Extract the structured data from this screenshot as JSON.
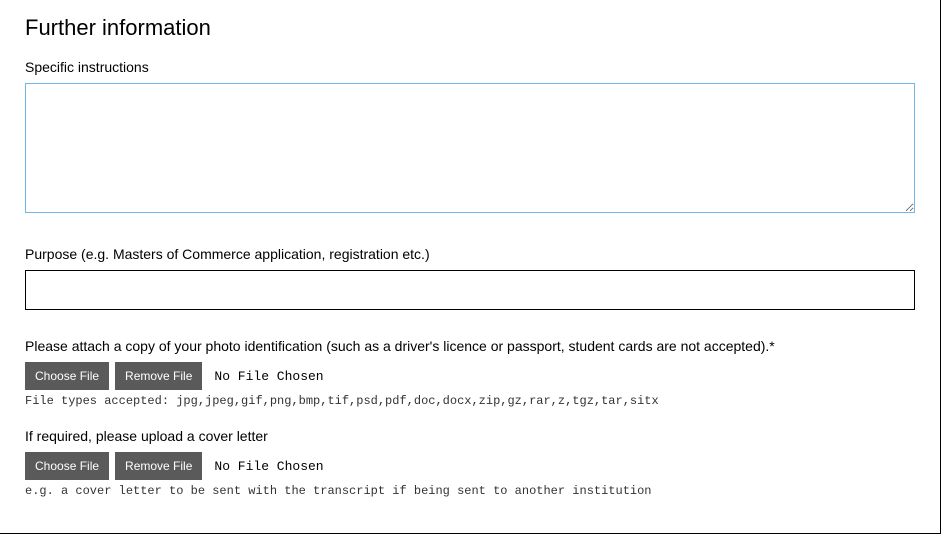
{
  "section_title": "Further information",
  "instructions": {
    "label": "Specific instructions",
    "value": ""
  },
  "purpose": {
    "label": "Purpose (e.g. Masters of Commerce application, registration etc.)",
    "value": ""
  },
  "photo_id": {
    "label": "Please attach a copy of your photo identification (such as a driver's licence or passport, student cards are not accepted).*",
    "choose_label": "Choose File",
    "remove_label": "Remove File",
    "status": "No File Chosen",
    "hint": "File types accepted: jpg,jpeg,gif,png,bmp,tif,psd,pdf,doc,docx,zip,gz,rar,z,tgz,tar,sitx"
  },
  "cover_letter": {
    "label": "If required, please upload a cover letter",
    "choose_label": "Choose File",
    "remove_label": "Remove File",
    "status": "No File Chosen",
    "hint": "e.g. a cover letter to be sent with the transcript if being sent to another institution"
  }
}
